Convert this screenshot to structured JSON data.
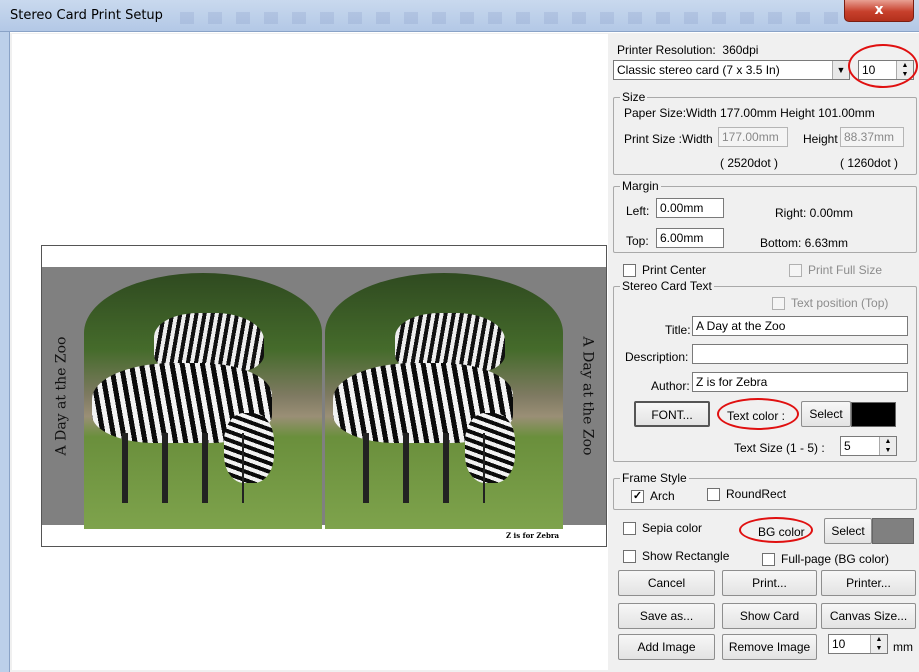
{
  "window": {
    "title": "Stereo Card Print Setup",
    "close_glyph": "x"
  },
  "card": {
    "side_text": "A Day at the Zoo",
    "footer_text": "Z is for Zebra",
    "bg_color": "#808080"
  },
  "printer": {
    "resolution_label": "Printer Resolution:",
    "resolution_value": "360dpi",
    "card_type": "Classic stereo card (7 x 3.5 In)",
    "count": "10"
  },
  "size": {
    "group_label": "Size",
    "paper_size_text": "Paper Size:Width 177.00mm Height 101.00mm",
    "print_size_label": "Print Size :Width",
    "print_width": "177.00mm",
    "height_label": "Height",
    "print_height": "88.37mm",
    "width_dots": "( 2520dot )",
    "height_dots": "( 1260dot )"
  },
  "margin": {
    "group_label": "Margin",
    "left_label": "Left:",
    "left_value": "0.00mm",
    "right_text": "Right:  0.00mm",
    "top_label": "Top:",
    "top_value": "6.00mm",
    "bottom_text": "Bottom:  6.63mm"
  },
  "options": {
    "print_center": "Print Center",
    "print_full_size": "Print Full Size"
  },
  "stereo_text": {
    "group_label": "Stereo Card Text",
    "text_position": "Text position (Top)",
    "title_label": "Title:",
    "title_value": "A Day at the Zoo",
    "description_label": "Description:",
    "description_value": "",
    "author_label": "Author:",
    "author_value": "Z is for Zebra",
    "font_button": "FONT...",
    "text_color_label": "Text color :",
    "select_button": "Select",
    "text_color": "#000000",
    "text_size_label": "Text Size (1 - 5) :",
    "text_size_value": "5"
  },
  "frame_style": {
    "group_label": "Frame Style",
    "arch": "Arch",
    "round_rect": "RoundRect"
  },
  "bg": {
    "sepia_color": "Sepia color",
    "bg_color_label": "BG color",
    "select_button": "Select",
    "bg_color": "#808080",
    "show_rectangle": "Show Rectangle",
    "full_page": "Full-page (BG color)"
  },
  "buttons": {
    "cancel": "Cancel",
    "print": "Print...",
    "printer": "Printer...",
    "save_as": "Save as...",
    "show_card": "Show Card",
    "canvas_size": "Canvas Size...",
    "add_image": "Add Image",
    "remove_image": "Remove Image"
  },
  "image_size": {
    "value": "10",
    "unit": "mm"
  },
  "highlight_color": "#e01010"
}
